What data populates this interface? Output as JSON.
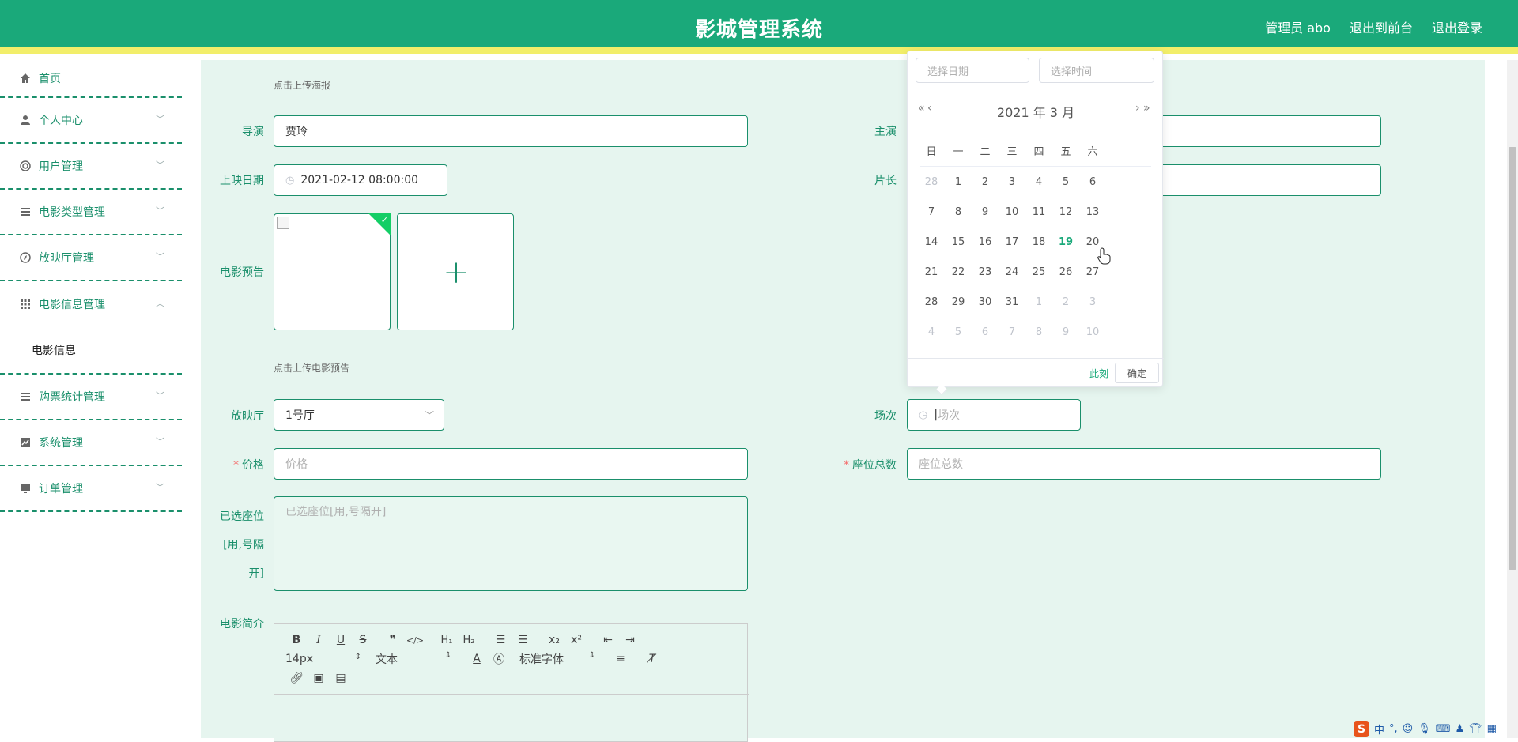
{
  "header": {
    "title": "影城管理系统",
    "admin_label": "管理员 abo",
    "front_link": "退出到前台",
    "logout_link": "退出登录"
  },
  "sidebar": {
    "items": [
      {
        "label": "首页",
        "icon": "home-icon"
      },
      {
        "label": "个人中心",
        "icon": "user-icon"
      },
      {
        "label": "用户管理",
        "icon": "users-icon"
      },
      {
        "label": "电影类型管理",
        "icon": "list-icon"
      },
      {
        "label": "放映厅管理",
        "icon": "compass-icon"
      },
      {
        "label": "电影信息管理",
        "icon": "grid-icon",
        "sub": "电影信息"
      },
      {
        "label": "购票统计管理",
        "icon": "list-icon"
      },
      {
        "label": "系统管理",
        "icon": "chart-icon"
      },
      {
        "label": "订单管理",
        "icon": "monitor-icon"
      }
    ]
  },
  "form": {
    "poster_hint": "点击上传海报",
    "director_label": "导演",
    "director_value": "贾玲",
    "lead_label": "主演",
    "release_label": "上映日期",
    "release_value": "2021-02-12 08:00:00",
    "duration_label": "片长",
    "trailer_label": "电影预告",
    "trailer_hint": "点击上传电影预告",
    "hall_label": "放映厅",
    "hall_value": "1号厅",
    "session_label": "场次",
    "session_placeholder": "场次",
    "price_label": "价格",
    "price_placeholder": "价格",
    "seats_label": "座位总数",
    "seats_placeholder": "座位总数",
    "selected_seats_label_1": "已选座位",
    "selected_seats_label_2": "[用,号隔",
    "selected_seats_label_3": "开]",
    "selected_seats_placeholder": "已选座位[用,号隔开]",
    "intro_label": "电影简介",
    "required_mark": "*"
  },
  "editor": {
    "font_size": "14px",
    "text_format": "文本",
    "font_family": "标准字体"
  },
  "picker": {
    "date_placeholder": "选择日期",
    "time_placeholder": "选择时间",
    "year_month": "2021 年  3 月",
    "weekdays": [
      "日",
      "一",
      "二",
      "三",
      "四",
      "五",
      "六"
    ],
    "weeks": [
      [
        "28",
        "1",
        "2",
        "3",
        "4",
        "5",
        "6"
      ],
      [
        "7",
        "8",
        "9",
        "10",
        "11",
        "12",
        "13"
      ],
      [
        "14",
        "15",
        "16",
        "17",
        "18",
        "19",
        "20"
      ],
      [
        "21",
        "22",
        "23",
        "24",
        "25",
        "26",
        "27"
      ],
      [
        "28",
        "29",
        "30",
        "31",
        "1",
        "2",
        "3"
      ],
      [
        "4",
        "5",
        "6",
        "7",
        "8",
        "9",
        "10"
      ]
    ],
    "today": "19",
    "now_label": "此刻",
    "ok_label": "确定"
  },
  "tray": {
    "ime_label": "中",
    "punct_label": "°,"
  },
  "colors": {
    "primary": "#1aa97a",
    "accent_border": "#f2ee6a",
    "content_bg": "#e6f5ef",
    "required": "#f56c6c"
  }
}
